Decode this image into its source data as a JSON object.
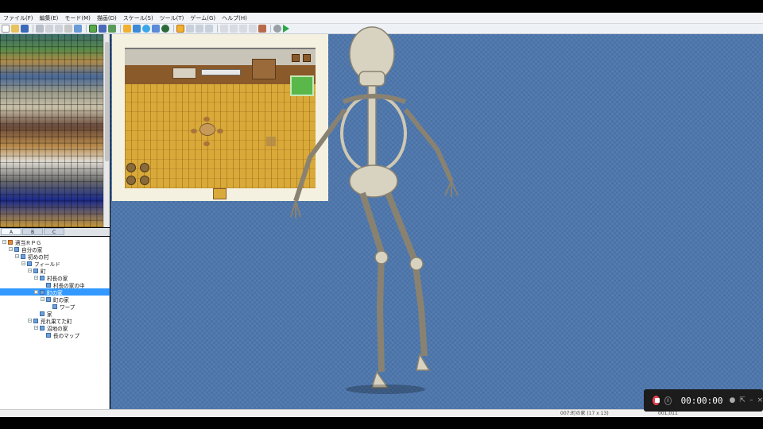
{
  "menu": [
    "ファイル(F)",
    "編集(E)",
    "モード(M)",
    "描画(D)",
    "スケール(S)",
    "ツール(T)",
    "ゲーム(G)",
    "ヘルプ(H)"
  ],
  "tabs": [
    "A",
    "B",
    "C"
  ],
  "tree": [
    {
      "label": "適当ＲＰＧ",
      "indent": 0,
      "root": true,
      "exp": "-"
    },
    {
      "label": "自分の家",
      "indent": 1,
      "exp": "-"
    },
    {
      "label": "初めの村",
      "indent": 2,
      "exp": "-"
    },
    {
      "label": "フィールド",
      "indent": 3,
      "exp": "-"
    },
    {
      "label": "町",
      "indent": 4,
      "exp": "-"
    },
    {
      "label": "村長の家",
      "indent": 5,
      "exp": "-"
    },
    {
      "label": "村長の家の中",
      "indent": 6,
      "exp": ""
    },
    {
      "label": "町の家",
      "indent": 5,
      "exp": "-",
      "selected": true
    },
    {
      "label": "町の家",
      "indent": 6,
      "exp": "-"
    },
    {
      "label": "ワープ",
      "indent": 7,
      "exp": ""
    },
    {
      "label": "家",
      "indent": 5,
      "exp": ""
    },
    {
      "label": "荒れ果てた町",
      "indent": 4,
      "exp": "-"
    },
    {
      "label": "沼地の家",
      "indent": 5,
      "exp": "-"
    },
    {
      "label": "長のマップ",
      "indent": 6,
      "exp": ""
    }
  ],
  "status": {
    "map": "007:町の家 (17 x 13)",
    "coord": "001,011"
  },
  "recorder": {
    "time": "00:00:00"
  },
  "colors": {
    "accent": "#3399ff",
    "record": "#e8434f",
    "canvas": "#4a73a8"
  }
}
